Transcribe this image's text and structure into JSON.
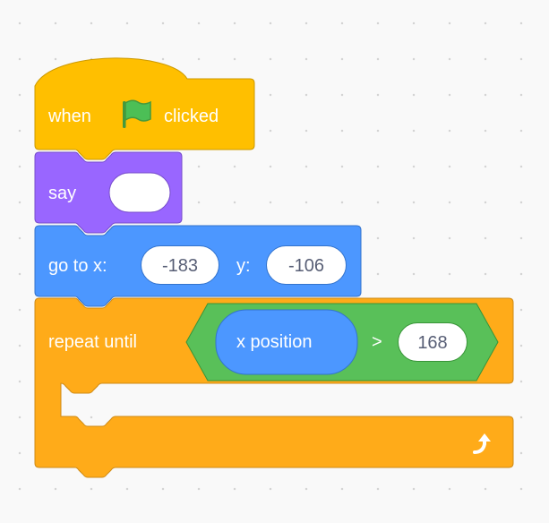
{
  "script": {
    "hat": {
      "prefix": "when",
      "suffix": "clicked",
      "flag_icon": "green-flag-icon"
    },
    "say": {
      "label": "say",
      "message": ""
    },
    "goto": {
      "label_x": "go to x:",
      "x_value": "-183",
      "label_y": "y:",
      "y_value": "-106"
    },
    "repeat_until": {
      "label": "repeat until",
      "condition": {
        "reporter": "x position",
        "operator": ">",
        "value": "168"
      },
      "loop_icon": "loop-arrow-icon"
    }
  },
  "colors": {
    "events": "#ffbf00",
    "looks": "#9966ff",
    "motion": "#4c97ff",
    "control": "#ffab19",
    "operators": "#59c059",
    "workspace": "#f9f9f9"
  }
}
